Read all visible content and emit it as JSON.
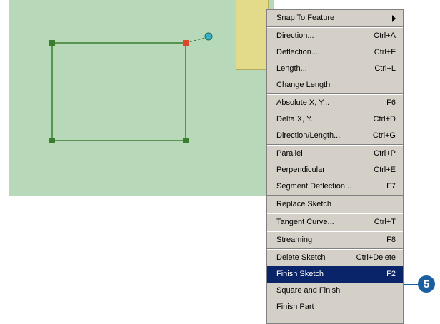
{
  "menu": {
    "items": [
      {
        "label": "Snap To Feature",
        "shortcut": ""
      },
      {
        "label": "Direction...",
        "shortcut": "Ctrl+A"
      },
      {
        "label": "Deflection...",
        "shortcut": "Ctrl+F"
      },
      {
        "label": "Length...",
        "shortcut": "Ctrl+L"
      },
      {
        "label": "Change Length",
        "shortcut": ""
      },
      {
        "label": "Absolute X, Y...",
        "shortcut": "F6"
      },
      {
        "label": "Delta X, Y...",
        "shortcut": "Ctrl+D"
      },
      {
        "label": "Direction/Length...",
        "shortcut": "Ctrl+G"
      },
      {
        "label": "Parallel",
        "shortcut": "Ctrl+P"
      },
      {
        "label": "Perpendicular",
        "shortcut": "Ctrl+E"
      },
      {
        "label": "Segment Deflection...",
        "shortcut": "F7"
      },
      {
        "label": "Replace Sketch",
        "shortcut": ""
      },
      {
        "label": "Tangent Curve...",
        "shortcut": "Ctrl+T"
      },
      {
        "label": "Streaming",
        "shortcut": "F8"
      },
      {
        "label": "Delete Sketch",
        "shortcut": "Ctrl+Delete"
      },
      {
        "label": "Finish Sketch",
        "shortcut": "F2"
      },
      {
        "label": "Square and Finish",
        "shortcut": ""
      },
      {
        "label": "Finish Part",
        "shortcut": ""
      }
    ],
    "highlighted_item": "Finish Sketch"
  },
  "callout": {
    "number": "5"
  },
  "colors": {
    "map_background": "#b7d9b9",
    "sketch_line": "#3a7d2c",
    "vertex": "#3a7d2c",
    "active_vertex": "#e0442b",
    "cursor_point": "#3ab0c8",
    "highlight": "#0a246a",
    "callout": "#1a5fa0"
  }
}
